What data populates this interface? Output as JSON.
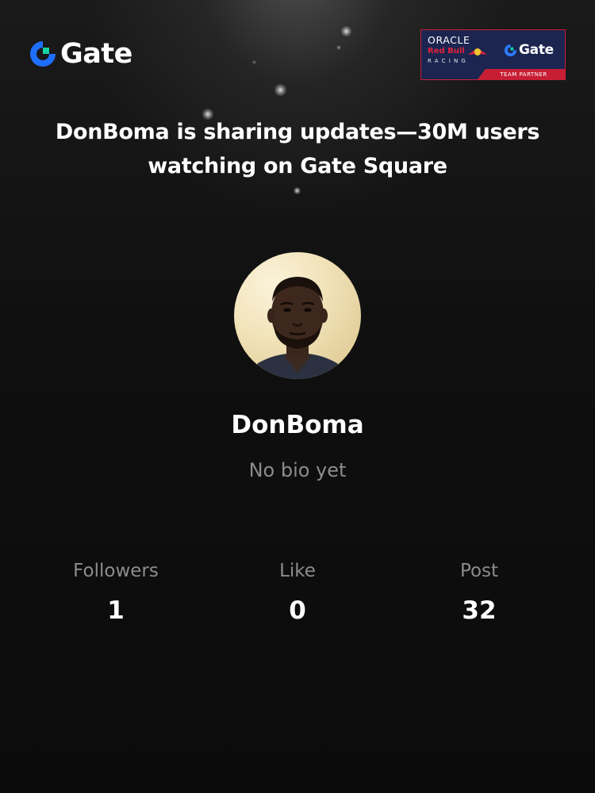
{
  "brand": {
    "logo_text": "Gate",
    "logo_icon": "gate-logo-icon",
    "accent_color": "#1f6fff",
    "accent_color_2": "#14d3a4"
  },
  "partner_badge": {
    "oracle_text": "ORACLE",
    "redbull_text": "Red Bull",
    "racing_text": "RACING",
    "gate_text": "Gate",
    "strip_text": "TEAM PARTNER",
    "background_color": "#1b2550",
    "strip_color": "#c81e35"
  },
  "headline": "DonBoma is sharing updates—30M users watching on Gate Square",
  "profile": {
    "avatar_icon": "user-avatar-photo",
    "username": "DonBoma",
    "bio": "No bio yet"
  },
  "stats": [
    {
      "label": "Followers",
      "value": "1"
    },
    {
      "label": "Like",
      "value": "0"
    },
    {
      "label": "Post",
      "value": "32"
    }
  ]
}
